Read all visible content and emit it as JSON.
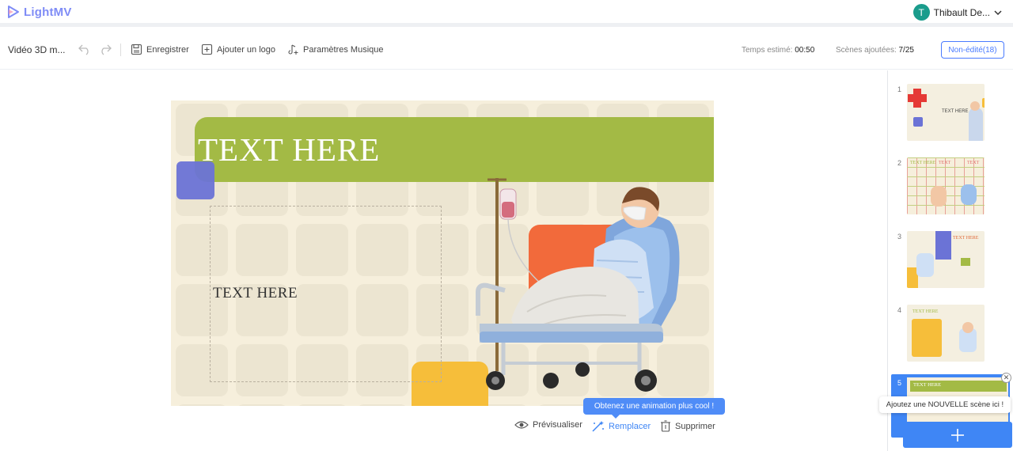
{
  "app": {
    "name": "LightMV"
  },
  "user": {
    "initial": "T",
    "name": "Thibault De..."
  },
  "toolbar": {
    "project_title": "Vidéo 3D m...",
    "save_label": "Enregistrer",
    "logo_label": "Ajouter un logo",
    "music_label": "Paramètres Musique",
    "time_label": "Temps estimé:",
    "time_value": "00:50",
    "scenes_label": "Scènes ajoutées:",
    "scenes_value": "7/25",
    "nonedit_label": "Non-édité(18)"
  },
  "canvas": {
    "title_text": "TEXT HERE",
    "body_text": "TEXT HERE"
  },
  "scene_actions": {
    "preview_label": "Prévisualiser",
    "replace_label": "Remplacer",
    "delete_label": "Supprimer",
    "tooltip": "Obtenez une animation plus cool !"
  },
  "sidebar": {
    "scenes": [
      {
        "num": "1",
        "text": "TEXT HERE"
      },
      {
        "num": "2",
        "text": "TEXT HERE"
      },
      {
        "num": "3",
        "text": "TEXT HERE"
      },
      {
        "num": "4",
        "text": "TEXT HERE"
      },
      {
        "num": "5",
        "text": "TEXT HERE"
      }
    ],
    "add_popup": "Ajoutez une NOUVELLE scène ici !"
  },
  "colors": {
    "accent": "#3f86f5",
    "logo": "#7f8cf6",
    "avatar": "#1a9c8c",
    "banner_green": "#a3ba45"
  }
}
